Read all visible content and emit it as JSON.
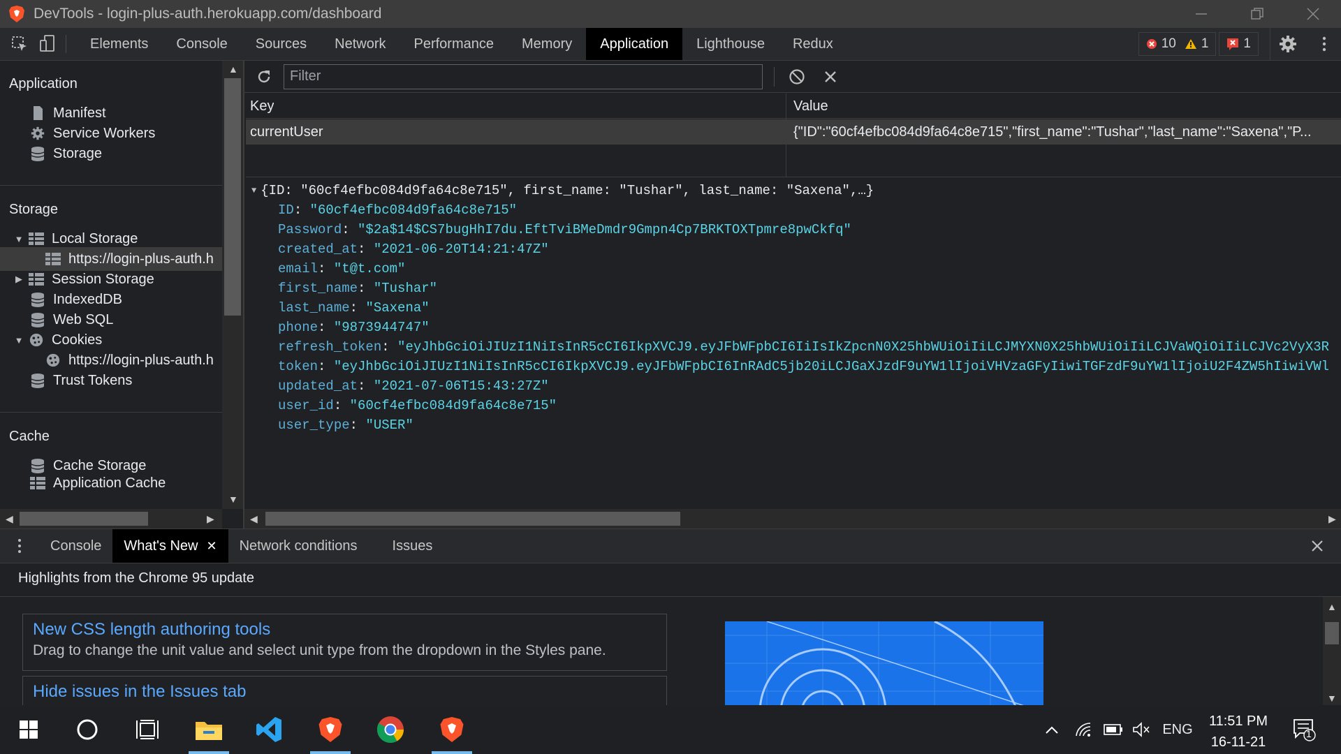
{
  "window": {
    "title": "DevTools - login-plus-auth.herokuapp.com/dashboard"
  },
  "toolbar": {
    "tabs": [
      "Elements",
      "Console",
      "Sources",
      "Network",
      "Performance",
      "Memory",
      "Application",
      "Lighthouse",
      "Redux"
    ],
    "active_tab": "Application",
    "errors": "10",
    "warnings": "1",
    "issues": "1"
  },
  "sidebar": {
    "application_title": "Application",
    "application_items": [
      "Manifest",
      "Service Workers",
      "Storage"
    ],
    "storage_title": "Storage",
    "storage_items": [
      "Local Storage",
      "https://login-plus-auth.h",
      "Session Storage",
      "IndexedDB",
      "Web SQL",
      "Cookies",
      "https://login-plus-auth.h",
      "Trust Tokens"
    ],
    "cache_title": "Cache",
    "cache_items": [
      "Cache Storage",
      "Application Cache"
    ]
  },
  "filter": {
    "placeholder": "Filter"
  },
  "table": {
    "key_header": "Key",
    "value_header": "Value",
    "rows": [
      {
        "key": "currentUser",
        "value": "{\"ID\":\"60cf4efbc084d9fa64c8e715\",\"first_name\":\"Tushar\",\"last_name\":\"Saxena\",\"P..."
      }
    ]
  },
  "preview": {
    "summary": "{ID: \"60cf4efbc084d9fa64c8e715\", first_name: \"Tushar\", last_name: \"Saxena\",…}",
    "props": [
      {
        "key": "ID",
        "value": "\"60cf4efbc084d9fa64c8e715\""
      },
      {
        "key": "Password",
        "value": "\"$2a$14$CS7bugHhI7du.EftTviBMeDmdr9Gmpn4Cp7BRKTOXTpmre8pwCkfq\""
      },
      {
        "key": "created_at",
        "value": "\"2021-06-20T14:21:47Z\""
      },
      {
        "key": "email",
        "value": "\"t@t.com\""
      },
      {
        "key": "first_name",
        "value": "\"Tushar\""
      },
      {
        "key": "last_name",
        "value": "\"Saxena\""
      },
      {
        "key": "phone",
        "value": "\"9873944747\""
      },
      {
        "key": "refresh_token",
        "value": "\"eyJhbGciOiJIUzI1NiIsInR5cCI6IkpXVCJ9.eyJFbWFpbCI6IiIsIkZpcnN0X25hbWUiOiIiLCJMYXN0X25hbWUiOiIiLCJVaWQiOiIiLCJVc2VyX3R"
      },
      {
        "key": "token",
        "value": "\"eyJhbGciOiJIUzI1NiIsInR5cCI6IkpXVCJ9.eyJFbWFpbCI6InRAdC5jb20iLCJGaXJzdF9uYW1lIjoiVHVzaGFyIiwiTGFzdF9uYW1lIjoiU2F4ZW5hIiwiVWl"
      },
      {
        "key": "updated_at",
        "value": "\"2021-07-06T15:43:27Z\""
      },
      {
        "key": "user_id",
        "value": "\"60cf4efbc084d9fa64c8e715\""
      },
      {
        "key": "user_type",
        "value": "\"USER\""
      }
    ]
  },
  "drawer": {
    "tabs": [
      "Console",
      "What's New",
      "Network conditions",
      "Issues"
    ],
    "active_tab": "What's New",
    "highlight": "Highlights from the Chrome 95 update",
    "cards": [
      {
        "title": "New CSS length authoring tools",
        "desc": "Drag to change the unit value and select unit type from the dropdown in the Styles pane."
      },
      {
        "title": "Hide issues in the Issues tab",
        "desc": ""
      }
    ]
  },
  "taskbar": {
    "lang": "ENG",
    "time": "11:51 PM",
    "date": "16-11-21",
    "notifications": "1"
  },
  "colors": {
    "accent": "#1a73e8",
    "link": "#5aa9ff",
    "key": "#5db0d7",
    "string": "#5ad4e6"
  }
}
